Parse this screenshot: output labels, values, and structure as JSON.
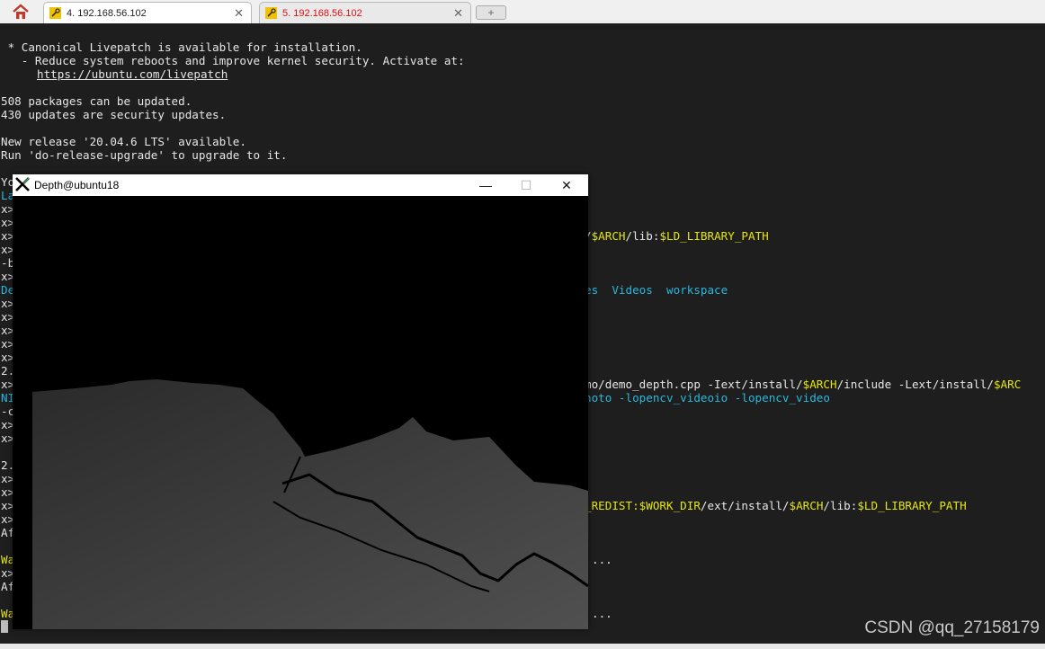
{
  "tabs": [
    {
      "label": "4. 192.168.56.102",
      "active": true
    },
    {
      "label": "5. 192.168.56.102",
      "active": false
    }
  ],
  "terminal": {
    "l1": " * Canonical Livepatch is available for installation.",
    "l2": "   - Reduce system reboots and improve kernel security. Activate at:",
    "l3": "https://ubuntu.com/livepatch",
    "l4": "508 packages can be updated.",
    "l5": "430 updates are security updates.",
    "l6": "New release '20.04.6 LTS' available.",
    "l7": "Run 'do-release-upgrade' to upgrade to it.",
    "l8": "Yo",
    "r1_a": "/",
    "r1_b": "$ARCH",
    "r1_c": "/lib:",
    "r1_d": "$LD_LIBRARY_PATH",
    "r2": "es  Videos  workspace",
    "r3": "mo/demo_depth.cpp -Iext/install/",
    "r3_b": "$ARCH",
    "r3_c": "/include -Lext/install/",
    "r3_d": "$ARC",
    "r4": "hoto -lopencv_videoio -lopencv_video",
    "r5_a": "_REDIST:",
    "r5_b": "$WORK_DIR",
    "r5_c": "/ext/install/",
    "r5_d": "$ARCH",
    "r5_e": "/lib:",
    "r5_f": "$LD_LIBRARY_PATH",
    "dots": "...",
    "left_col": [
      "La",
      "x>",
      "x>",
      "x>",
      "x>",
      "-b",
      "x>",
      "De",
      "x>",
      "x>",
      "x>",
      "x>",
      "x>",
      "2.",
      "x>",
      "NI",
      "-c",
      "x>",
      "x>",
      "",
      "2.",
      "x>",
      "x>",
      "x>",
      "x>",
      "Af",
      "",
      "Wa",
      "x>",
      "Af",
      "",
      "Wa"
    ]
  },
  "window": {
    "title": "Depth@ubuntu18",
    "min": "—",
    "max": "☐",
    "close": "✕"
  },
  "watermark": "CSDN @qq_27158179"
}
